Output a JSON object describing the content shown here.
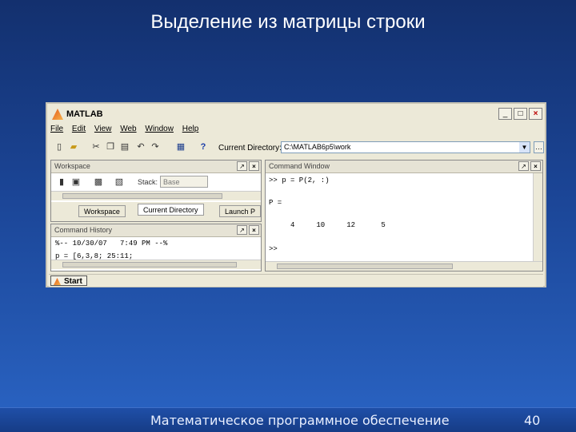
{
  "slide": {
    "title": "Выделение из матрицы строки",
    "footer": "Математическое программное обеспечение",
    "page_number": "40"
  },
  "app": {
    "title": "MATLAB",
    "window_buttons": [
      "_",
      "□",
      "×"
    ]
  },
  "menu": [
    "File",
    "Edit",
    "View",
    "Web",
    "Window",
    "Help"
  ],
  "toolbar": {
    "current_dir_label": "Current Directory:",
    "current_dir_value": "C:\\MATLAB6p5\\work",
    "icons": [
      "new-file-icon",
      "open-folder-icon",
      "cut-icon",
      "copy-icon",
      "paste-icon",
      "undo-icon",
      "redo-icon",
      "simulink-icon",
      "help-icon"
    ]
  },
  "workspace": {
    "title": "Workspace",
    "stack_label": "Stack:",
    "stack_value": "Base",
    "tabs": [
      "Workspace",
      "Current Directory",
      "Launch P"
    ]
  },
  "history": {
    "title": "Command History",
    "lines": [
      "%-- 10/30/07   7:49 PM --%",
      "p = [6,3,8; 25:11;"
    ]
  },
  "command": {
    "title": "Command Window",
    "lines": [
      ">> p = P(2, :)",
      "",
      "P =",
      "",
      "     4     10     12      5",
      "",
      ">>"
    ]
  },
  "status": {
    "start_label": "Start"
  }
}
